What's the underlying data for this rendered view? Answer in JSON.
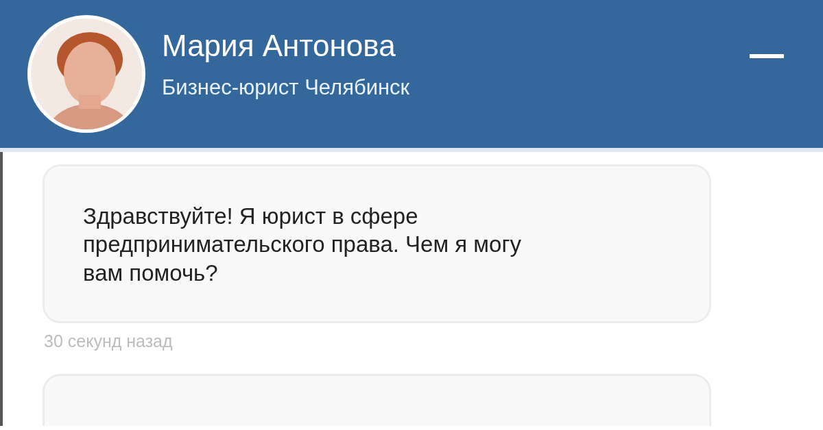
{
  "header": {
    "name": "Мария Антонова",
    "subtitle": "Бизнес-юрист Челябинск"
  },
  "messages": [
    {
      "text": "Здравствуйте! Я юрист в сфере предпринимательского права. Чем я могу вам помочь?",
      "time": "30 секунд назад"
    }
  ]
}
